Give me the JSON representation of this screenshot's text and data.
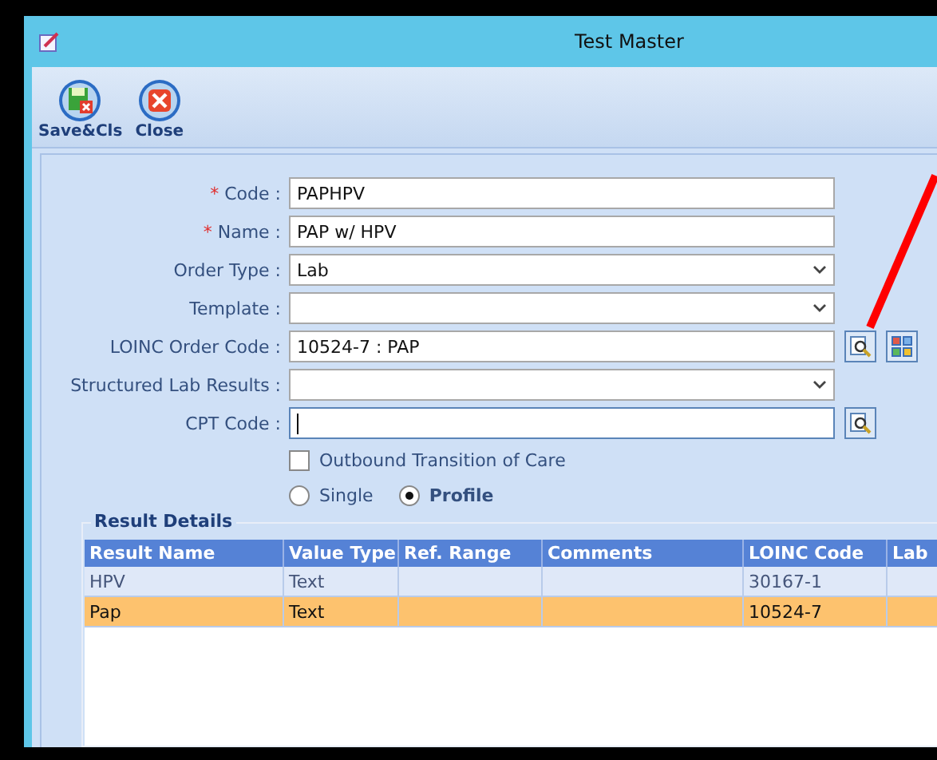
{
  "window": {
    "title": "Test Master"
  },
  "toolbar": [
    {
      "kind": "save",
      "label": "Save&Cls"
    },
    {
      "kind": "close",
      "label": "Close"
    }
  ],
  "fields": [
    {
      "kind": "text",
      "label": "Code :",
      "required_mark": "*",
      "value": "PAPHPV"
    },
    {
      "kind": "text",
      "label": "Name :",
      "required_mark": "*",
      "value": "PAP w/ HPV"
    },
    {
      "kind": "select",
      "label": "Order Type :",
      "value": "Lab"
    },
    {
      "kind": "select",
      "label": "Template :"
    },
    {
      "kind": "lookup-grid",
      "label": "LOINC Order Code :",
      "value": "10524-7 : PAP"
    },
    {
      "kind": "select",
      "label": "Structured Lab Results :"
    },
    {
      "kind": "lookup",
      "label": "CPT Code :",
      "focused": true
    }
  ],
  "outbound": {
    "label": "Outbound Transition of Care",
    "checked": false
  },
  "radios": [
    {
      "label": "Single",
      "selected": false
    },
    {
      "label": "Profile",
      "selected": true
    }
  ],
  "result_details": {
    "title": "Result Details",
    "columns": [
      "Result Name",
      "Value Type",
      "Ref. Range",
      "Comments",
      "LOINC Code",
      "Lab"
    ],
    "rows": [
      {
        "cells": [
          "HPV",
          "Text",
          "",
          "",
          "30167-1",
          ""
        ],
        "selected": false
      },
      {
        "cells": [
          "Pap",
          "Text",
          "",
          "",
          "10524-7",
          ""
        ],
        "selected": true
      }
    ]
  }
}
